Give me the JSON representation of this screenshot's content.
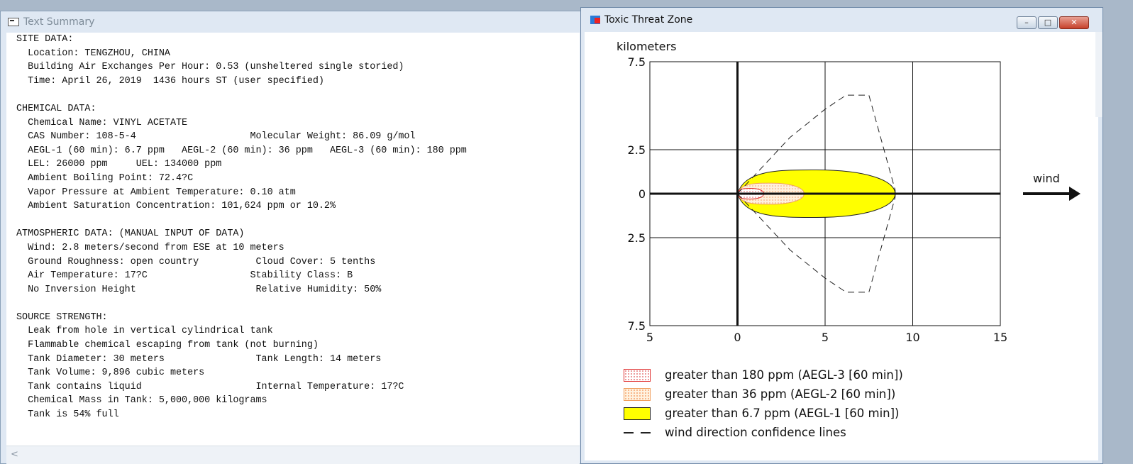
{
  "text_summary": {
    "title": "Text Summary",
    "lines": [
      "SITE DATA:",
      "  Location: TENGZHOU, CHINA",
      "  Building Air Exchanges Per Hour: 0.53 (unsheltered single storied)",
      "  Time: April 26, 2019  1436 hours ST (user specified)",
      "",
      "CHEMICAL DATA:",
      "  Chemical Name: VINYL ACETATE",
      "  CAS Number: 108-5-4                    Molecular Weight: 86.09 g/mol",
      "  AEGL-1 (60 min): 6.7 ppm   AEGL-2 (60 min): 36 ppm   AEGL-3 (60 min): 180 ppm",
      "  LEL: 26000 ppm     UEL: 134000 ppm",
      "  Ambient Boiling Point: 72.4?C",
      "  Vapor Pressure at Ambient Temperature: 0.10 atm",
      "  Ambient Saturation Concentration: 101,624 ppm or 10.2%",
      "",
      "ATMOSPHERIC DATA: (MANUAL INPUT OF DATA)",
      "  Wind: 2.8 meters/second from ESE at 10 meters",
      "  Ground Roughness: open country          Cloud Cover: 5 tenths",
      "  Air Temperature: 17?C                  Stability Class: B",
      "  No Inversion Height                     Relative Humidity: 50%",
      "",
      "SOURCE STRENGTH:",
      "  Leak from hole in vertical cylindrical tank",
      "  Flammable chemical escaping from tank (not burning)",
      "  Tank Diameter: 30 meters                Tank Length: 14 meters",
      "  Tank Volume: 9,896 cubic meters",
      "  Tank contains liquid                    Internal Temperature: 17?C",
      "  Chemical Mass in Tank: 5,000,000 kilograms",
      "  Tank is 54% full"
    ],
    "scroll_left_arrow": "<"
  },
  "threat_zone": {
    "title": "Toxic Threat Zone",
    "window_buttons": {
      "minimize": "–",
      "maximize": "□",
      "close": "✕"
    },
    "y_unit": "kilometers",
    "x_unit": "kilometers",
    "wind_label": "wind",
    "legend": [
      {
        "label": "greater than 180 ppm (AEGL-3 [60 min])",
        "swatch": "red-dotted"
      },
      {
        "label": "greater than 36 ppm (AEGL-2 [60 min])",
        "swatch": "orange-dotted"
      },
      {
        "label": "greater than 6.7 ppm (AEGL-1 [60 min])",
        "swatch": "yellow"
      },
      {
        "label": "wind direction confidence lines",
        "swatch": "dashed"
      }
    ]
  },
  "chart_data": {
    "type": "area",
    "x_ticks": [
      "5",
      "0",
      "5",
      "10",
      "15"
    ],
    "y_ticks": [
      "7.5",
      "2.5",
      "0",
      "2.5",
      "7.5"
    ],
    "xlim": [
      -5,
      15
    ],
    "ylim": [
      -7.5,
      7.5
    ],
    "xlabel": "kilometers",
    "ylabel": "kilometers",
    "grid": true,
    "zones": [
      {
        "name": "greater than 180 ppm (AEGL-3 [60 min])",
        "color": "#e03030",
        "x_extent": [
          0,
          1.5
        ],
        "half_width": 0.3
      },
      {
        "name": "greater than 36 ppm (AEGL-2 [60 min])",
        "color": "#f5a36d",
        "x_extent": [
          0,
          3.8
        ],
        "half_width": 0.6
      },
      {
        "name": "greater than 6.7 ppm (AEGL-1 [60 min])",
        "color": "#ffff00",
        "x_extent": [
          0,
          9.0
        ],
        "half_width": 1.35
      }
    ],
    "confidence_lines": {
      "upper": [
        [
          0,
          0
        ],
        [
          3,
          3.2
        ],
        [
          5,
          4.8
        ],
        [
          6.2,
          5.6
        ],
        [
          7.5,
          5.6
        ],
        [
          9,
          0.2
        ]
      ],
      "lower": [
        [
          0,
          0
        ],
        [
          3,
          -3.2
        ],
        [
          5,
          -4.8
        ],
        [
          6.2,
          -5.6
        ],
        [
          7.5,
          -5.6
        ],
        [
          9,
          -0.2
        ]
      ]
    }
  }
}
